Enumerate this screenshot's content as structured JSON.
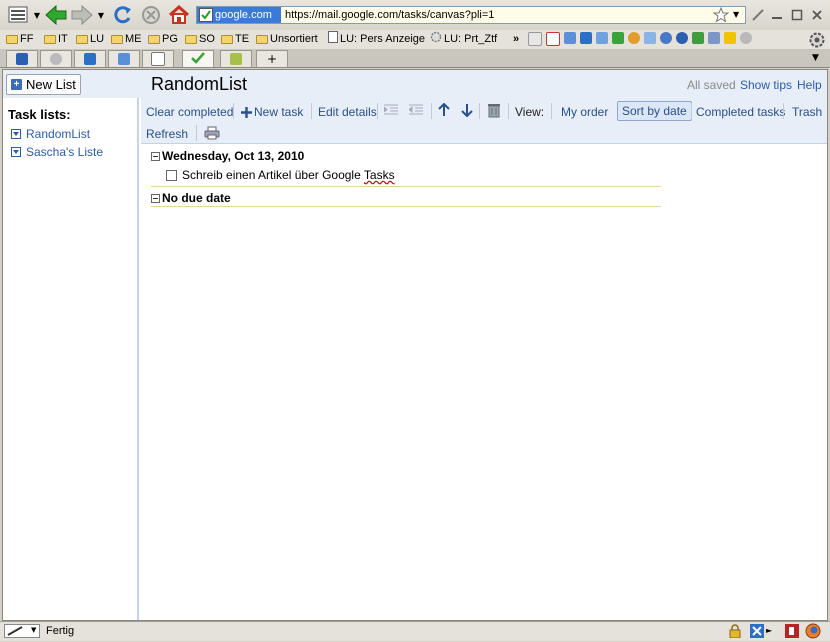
{
  "browser": {
    "url_site_label": "google.com",
    "url": "https://mail.google.com/tasks/canvas?pli=1",
    "bookmarks": [
      "FF",
      "IT",
      "LU",
      "ME",
      "PG",
      "SO",
      "TE",
      "Unsortiert",
      "LU: Pers Anzeige",
      "LU: Prt_Ztf"
    ],
    "bookmarks_overflow": "»",
    "tab_plus": "+",
    "status_text": "Fertig"
  },
  "app": {
    "new_list_label": "New List",
    "list_title": "RandomList",
    "status": "All saved",
    "show_tips": "Show tips",
    "help": "Help"
  },
  "sidebar": {
    "heading": "Task lists:",
    "items": [
      {
        "label": "RandomList"
      },
      {
        "label": "Sascha's Liste"
      }
    ]
  },
  "toolbar": {
    "clear_completed": "Clear completed",
    "new_task": "New task",
    "edit_details": "Edit details",
    "view_label": "View:",
    "my_order": "My order",
    "sort_by_date": "Sort by date",
    "completed_tasks": "Completed tasks",
    "trash": "Trash",
    "refresh": "Refresh"
  },
  "groups": [
    {
      "title": "Wednesday, Oct 13, 2010",
      "tasks": [
        {
          "text_before": "Schreib einen Artikel über Google ",
          "text_underlined": "Tasks"
        }
      ]
    },
    {
      "title": "No due date",
      "tasks": []
    }
  ]
}
